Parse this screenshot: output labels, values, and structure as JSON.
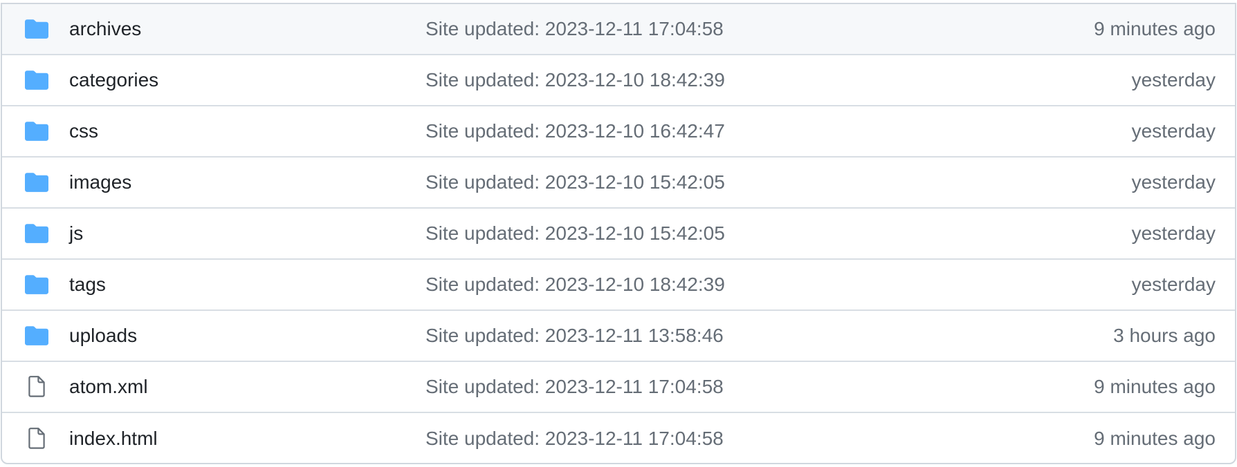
{
  "colors": {
    "folder": "#54aeff",
    "file": "#656d76",
    "text": "#1f2328",
    "muted": "#656d76",
    "border": "#d0d7de"
  },
  "rows": [
    {
      "type": "folder",
      "icon": "folder-icon",
      "name": "archives",
      "commit": "Site updated: 2023-12-11 17:04:58",
      "age": "9 minutes ago"
    },
    {
      "type": "folder",
      "icon": "folder-icon",
      "name": "categories",
      "commit": "Site updated: 2023-12-10 18:42:39",
      "age": "yesterday"
    },
    {
      "type": "folder",
      "icon": "folder-icon",
      "name": "css",
      "commit": "Site updated: 2023-12-10 16:42:47",
      "age": "yesterday"
    },
    {
      "type": "folder",
      "icon": "folder-icon",
      "name": "images",
      "commit": "Site updated: 2023-12-10 15:42:05",
      "age": "yesterday"
    },
    {
      "type": "folder",
      "icon": "folder-icon",
      "name": "js",
      "commit": "Site updated: 2023-12-10 15:42:05",
      "age": "yesterday"
    },
    {
      "type": "folder",
      "icon": "folder-icon",
      "name": "tags",
      "commit": "Site updated: 2023-12-10 18:42:39",
      "age": "yesterday"
    },
    {
      "type": "folder",
      "icon": "folder-icon",
      "name": "uploads",
      "commit": "Site updated: 2023-12-11 13:58:46",
      "age": "3 hours ago"
    },
    {
      "type": "file",
      "icon": "file-icon",
      "name": "atom.xml",
      "commit": "Site updated: 2023-12-11 17:04:58",
      "age": "9 minutes ago"
    },
    {
      "type": "file",
      "icon": "file-icon",
      "name": "index.html",
      "commit": "Site updated: 2023-12-11 17:04:58",
      "age": "9 minutes ago"
    }
  ]
}
